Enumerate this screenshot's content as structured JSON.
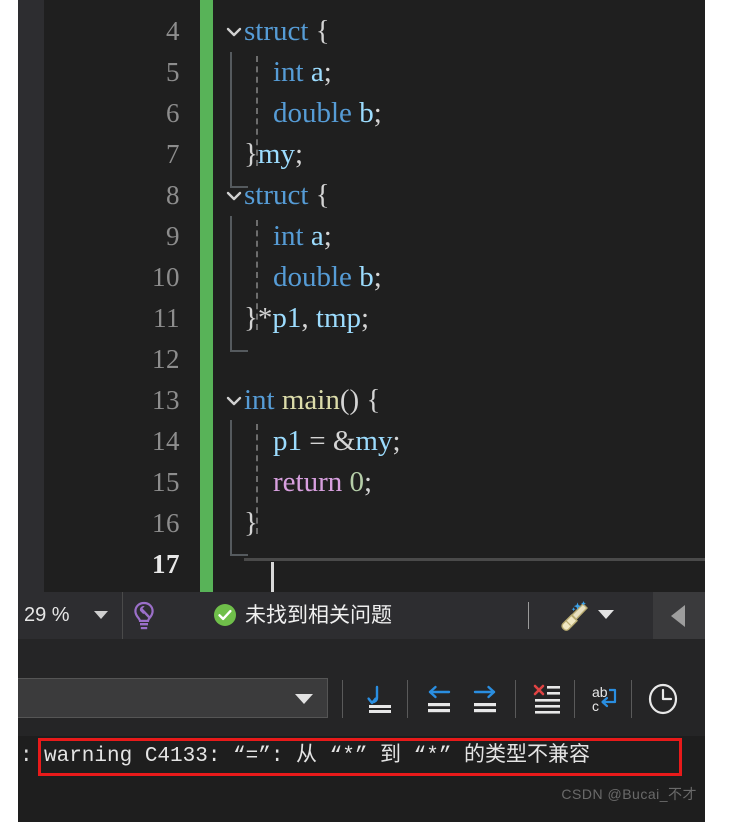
{
  "editor": {
    "change_bar_color": "#58b358",
    "background": "#1e1e1e",
    "lines": [
      {
        "num": "4",
        "collapsible": true,
        "text": "struct {",
        "tokens": [
          {
            "t": "struct",
            "c": "kw-blue"
          },
          {
            "t": " {",
            "c": "punct"
          }
        ]
      },
      {
        "num": "5",
        "collapsible": false,
        "text": "    int a;",
        "tokens": [
          {
            "t": "    ",
            "c": "plain"
          },
          {
            "t": "int",
            "c": "kw-blue"
          },
          {
            "t": " ",
            "c": "plain"
          },
          {
            "t": "a",
            "c": "id-pale"
          },
          {
            "t": ";",
            "c": "punct"
          }
        ]
      },
      {
        "num": "6",
        "collapsible": false,
        "text": "    double b;",
        "tokens": [
          {
            "t": "    ",
            "c": "plain"
          },
          {
            "t": "double",
            "c": "kw-blue"
          },
          {
            "t": " ",
            "c": "plain"
          },
          {
            "t": "b",
            "c": "id-pale"
          },
          {
            "t": ";",
            "c": "punct"
          }
        ]
      },
      {
        "num": "7",
        "collapsible": false,
        "text": "}my;",
        "tokens": [
          {
            "t": "}",
            "c": "punct"
          },
          {
            "t": "my",
            "c": "id-pale"
          },
          {
            "t": ";",
            "c": "punct"
          }
        ]
      },
      {
        "num": "8",
        "collapsible": true,
        "text": "struct {",
        "tokens": [
          {
            "t": "struct",
            "c": "kw-blue"
          },
          {
            "t": " {",
            "c": "punct"
          }
        ]
      },
      {
        "num": "9",
        "collapsible": false,
        "text": "    int a;",
        "tokens": [
          {
            "t": "    ",
            "c": "plain"
          },
          {
            "t": "int",
            "c": "kw-blue"
          },
          {
            "t": " ",
            "c": "plain"
          },
          {
            "t": "a",
            "c": "id-pale"
          },
          {
            "t": ";",
            "c": "punct"
          }
        ]
      },
      {
        "num": "10",
        "collapsible": false,
        "text": "    double b;",
        "tokens": [
          {
            "t": "    ",
            "c": "plain"
          },
          {
            "t": "double",
            "c": "kw-blue"
          },
          {
            "t": " ",
            "c": "plain"
          },
          {
            "t": "b",
            "c": "id-pale"
          },
          {
            "t": ";",
            "c": "punct"
          }
        ]
      },
      {
        "num": "11",
        "collapsible": false,
        "text": "}*p1, tmp;",
        "tokens": [
          {
            "t": "}*",
            "c": "punct"
          },
          {
            "t": "p1",
            "c": "id-pale"
          },
          {
            "t": ", ",
            "c": "punct"
          },
          {
            "t": "tmp",
            "c": "id-pale"
          },
          {
            "t": ";",
            "c": "punct"
          }
        ]
      },
      {
        "num": "12",
        "collapsible": false,
        "text": "",
        "tokens": []
      },
      {
        "num": "13",
        "collapsible": true,
        "text": "int main() {",
        "tokens": [
          {
            "t": "int",
            "c": "kw-blue"
          },
          {
            "t": " ",
            "c": "plain"
          },
          {
            "t": "main",
            "c": "fn-yellow"
          },
          {
            "t": "() {",
            "c": "punct"
          }
        ]
      },
      {
        "num": "14",
        "collapsible": false,
        "text": "    p1 = &my;",
        "tokens": [
          {
            "t": "    ",
            "c": "plain"
          },
          {
            "t": "p1",
            "c": "id-pale"
          },
          {
            "t": " = &",
            "c": "punct"
          },
          {
            "t": "my",
            "c": "id-pale"
          },
          {
            "t": ";",
            "c": "punct"
          }
        ]
      },
      {
        "num": "15",
        "collapsible": false,
        "text": "    return 0;",
        "tokens": [
          {
            "t": "    ",
            "c": "plain"
          },
          {
            "t": "return",
            "c": "kw-pink"
          },
          {
            "t": " ",
            "c": "plain"
          },
          {
            "t": "0",
            "c": "num-green"
          },
          {
            "t": ";",
            "c": "punct"
          }
        ]
      },
      {
        "num": "16",
        "collapsible": false,
        "text": "}",
        "tokens": [
          {
            "t": "}",
            "c": "punct"
          }
        ]
      },
      {
        "num": "17",
        "collapsible": false,
        "text": "",
        "tokens": [],
        "current": true
      }
    ]
  },
  "status_bar": {
    "zoom_level": "29 %",
    "zoom_dropdown_icon": "chevron-down-icon",
    "quick_actions_icon": "lightbulb-wrench-icon",
    "issues_icon": "check-circle-icon",
    "issues_text": "未找到相关问题",
    "cleanup_icon": "broom-icon",
    "cleanup_dropdown_icon": "chevron-down-icon",
    "scroll_left_icon": "triangle-left-icon"
  },
  "output_window": {
    "source_select_value": "",
    "source_select_icon": "chevron-down-icon",
    "toolbar_buttons": [
      {
        "name": "go-to-message-icon",
        "title": ""
      },
      {
        "name": "previous-message-icon",
        "title": ""
      },
      {
        "name": "next-message-icon",
        "title": ""
      },
      {
        "name": "clear-all-icon",
        "title": ""
      },
      {
        "name": "word-wrap-icon",
        "title": ""
      },
      {
        "name": "toggle-timestamps-icon",
        "title": ""
      }
    ],
    "message_prefix": ":",
    "message_text": "warning C4133: “=”: 从 “*” 到 “*” 的类型不兼容",
    "highlight_color": "#e81a1a"
  },
  "watermark": {
    "text": "CSDN @Bucai_不才"
  }
}
